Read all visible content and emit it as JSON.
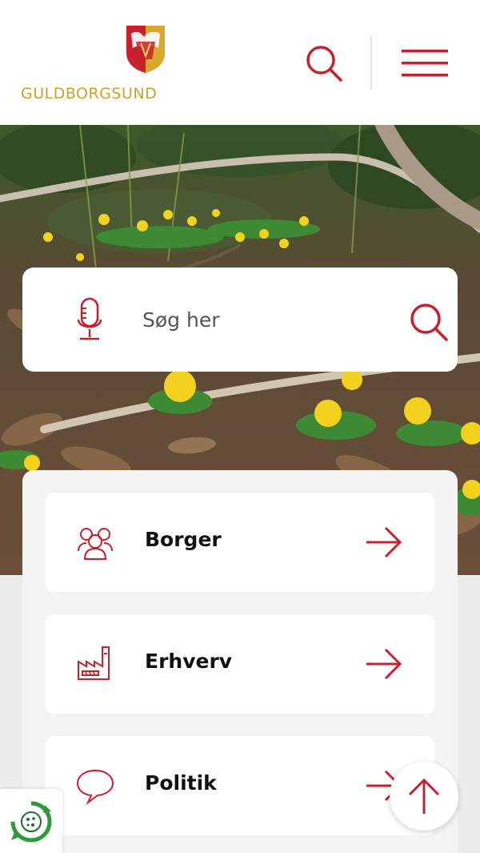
{
  "brand": {
    "name": "GULDBORGSUND",
    "logo_icon": "municipal-crest-icon",
    "gold": "#c9a227",
    "red": "#c8202f"
  },
  "header": {
    "search_icon": "search-icon",
    "menu_icon": "hamburger-menu-icon"
  },
  "search": {
    "placeholder": "Søg her",
    "value": "",
    "mic_icon": "microphone-icon",
    "submit_icon": "search-icon"
  },
  "nav": {
    "items": [
      {
        "label": "Borger",
        "icon": "people-icon",
        "arrow_icon": "arrow-right-icon"
      },
      {
        "label": "Erhverv",
        "icon": "factory-icon",
        "arrow_icon": "arrow-right-icon"
      },
      {
        "label": "Politik",
        "icon": "speech-bubble-icon",
        "arrow_icon": "arrow-right-icon"
      }
    ]
  },
  "floating": {
    "scroll_top_icon": "arrow-up-icon",
    "cookie_icon": "cookie-settings-icon"
  },
  "hero": {
    "image_subject": "winter-aconite-flowers-on-forest-floor"
  }
}
